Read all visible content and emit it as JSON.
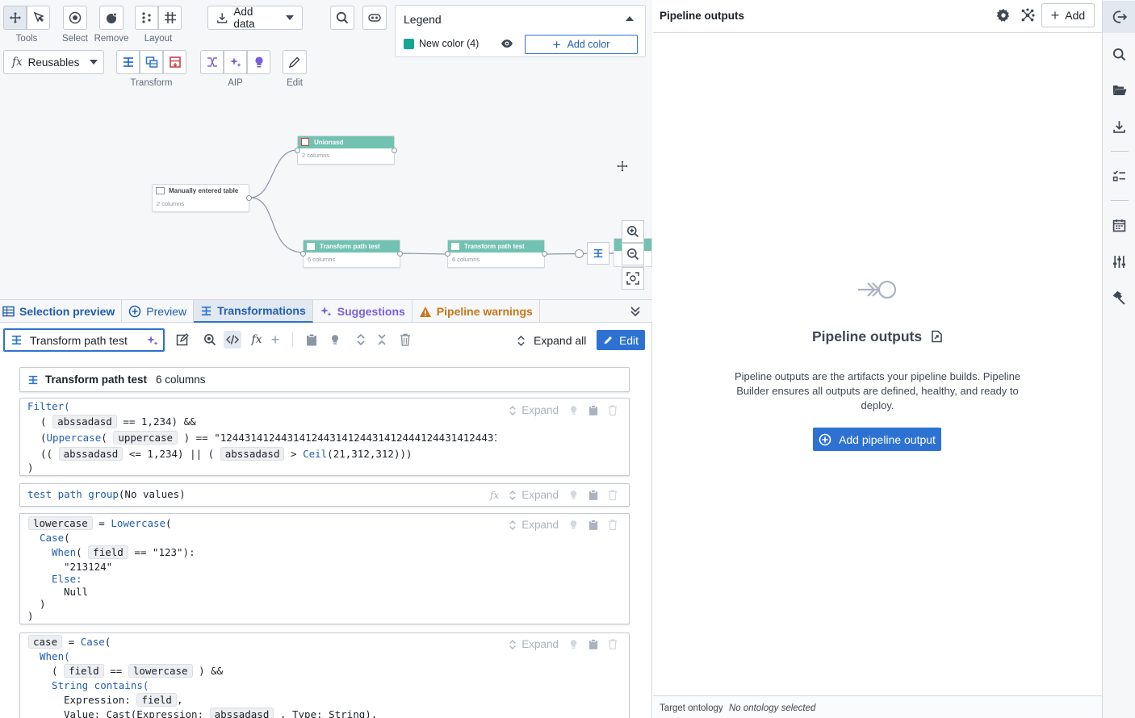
{
  "toolbar": {
    "tools_label": "Tools",
    "select_label": "Select",
    "remove_label": "Remove",
    "layout_label": "Layout",
    "add_data_label": "Add data",
    "reusables_label": "Reusables",
    "transform_label": "Transform",
    "aip_label": "AIP",
    "edit_label": "Edit"
  },
  "legend": {
    "title": "Legend",
    "item_label": "New color",
    "item_count": "(4)",
    "item_color": "#16a695",
    "add_color_label": "Add color"
  },
  "graph": {
    "nodes": {
      "unionasd": {
        "title": "Unionasd",
        "sub": "2 columns"
      },
      "manual": {
        "title": "Manually entered table",
        "sub": "2 columns"
      },
      "tpt1": {
        "title": "Transform path test",
        "sub": "6 columns"
      },
      "tpt2": {
        "title": "Transform path test",
        "sub": "6 columns"
      }
    },
    "node_color": "#72c2b2"
  },
  "tabs": [
    {
      "label": "Selection preview"
    },
    {
      "label": "Preview"
    },
    {
      "label": "Transformations"
    },
    {
      "label": "Suggestions"
    },
    {
      "label": "Pipeline warnings"
    }
  ],
  "editbar": {
    "name": "Transform path test",
    "expand_all_label": "Expand all",
    "edit_label": "Edit"
  },
  "summary": {
    "title": "Transform path test",
    "columns": "6 columns"
  },
  "cards": {
    "expand_label": "Expand",
    "filter": {
      "l1": "Filter(",
      "l2_col": "abssadasd",
      "l2_rest": "== 1,234) &&",
      "l3_fn": "Uppercase",
      "l3_col": "uppercase",
      "l3_rest": ") == \"12443141244314124431412443141244412443141244314124",
      "l4_col1": "abssadasd",
      "l4_mid": "<= 1,234) || (",
      "l4_col2": "abssadasd",
      "l4_gt": ">",
      "l4_fn": "Ceil",
      "l4_args": "(21,312,312)))",
      "l5": ")"
    },
    "group": {
      "name": "test path group",
      "rest": "(No values)"
    },
    "lower": {
      "col": "lowercase",
      "fn": "Lowercase",
      "case": "Case",
      "when": "When",
      "field": "field",
      "cond": "== \"123\"):",
      "val": "\"213124\"",
      "else": "Else:",
      "null": "Null",
      "close1": ")",
      "close2": ")"
    },
    "case": {
      "col": "case",
      "fn": "Case",
      "when": "When(",
      "field": "field",
      "eq": "==",
      "col2": "lowercase",
      "and": ") &&",
      "contains": "String contains(",
      "expr_label": "Expression:",
      "expr_col": "field",
      "value_line": "Value: Cast(Expression:",
      "value_col": "abssadasd",
      "value_rest": ", Type: String),"
    }
  },
  "right": {
    "title": "Pipeline outputs",
    "add_label": "Add",
    "empty_title": "Pipeline outputs",
    "empty_desc": "Pipeline outputs are the artifacts your pipeline builds. Pipeline Builder ensures all outputs are defined, healthy, and ready to deploy.",
    "add_output_label": "Add pipeline output",
    "footer_label": "Target ontology",
    "footer_value": "No ontology selected"
  },
  "colors": {
    "primary": "#2d72d2",
    "warning": "#c87619",
    "aip": "#7961db",
    "transform": "#cd4246"
  }
}
